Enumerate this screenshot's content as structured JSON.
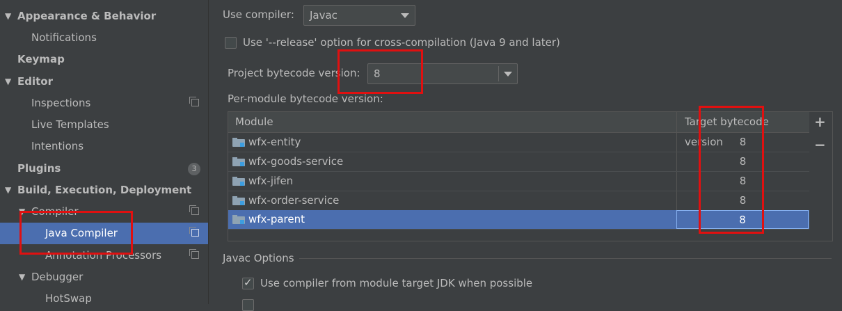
{
  "sidebar": {
    "items": [
      {
        "label": "Appearance & Behavior"
      },
      {
        "label": "Notifications"
      },
      {
        "label": "Keymap"
      },
      {
        "label": "Editor"
      },
      {
        "label": "Inspections"
      },
      {
        "label": "Live Templates"
      },
      {
        "label": "Intentions"
      },
      {
        "label": "Plugins",
        "badge": "3"
      },
      {
        "label": "Build, Execution, Deployment"
      },
      {
        "label": "Compiler"
      },
      {
        "label": "Java Compiler"
      },
      {
        "label": "Annotation Processors"
      },
      {
        "label": "Debugger"
      },
      {
        "label": "HotSwap"
      }
    ]
  },
  "compiler": {
    "use_compiler_label": "Use compiler:",
    "use_compiler_value": "Javac",
    "release_option_label": "Use '--release' option for cross-compilation (Java 9 and later)",
    "release_option_checked": false,
    "project_bytecode_label": "Project bytecode version:",
    "project_bytecode_value": "8",
    "per_module_label": "Per-module bytecode version:"
  },
  "module_table": {
    "headers": {
      "module": "Module",
      "target": "Target bytecode version"
    },
    "rows": [
      {
        "module": "wfx-entity",
        "version": "8"
      },
      {
        "module": "wfx-goods-service",
        "version": "8"
      },
      {
        "module": "wfx-jifen",
        "version": "8"
      },
      {
        "module": "wfx-order-service",
        "version": "8"
      },
      {
        "module": "wfx-parent",
        "version": "8"
      }
    ],
    "add_label": "+",
    "remove_label": "−"
  },
  "javac_options": {
    "title": "Javac Options",
    "use_module_target_jdk_label": "Use compiler from module target JDK when possible",
    "use_module_target_jdk_checked": true
  },
  "colors": {
    "background": "#3c3f41",
    "selection": "#4b6eaf",
    "annotation_red": "#e01010"
  }
}
